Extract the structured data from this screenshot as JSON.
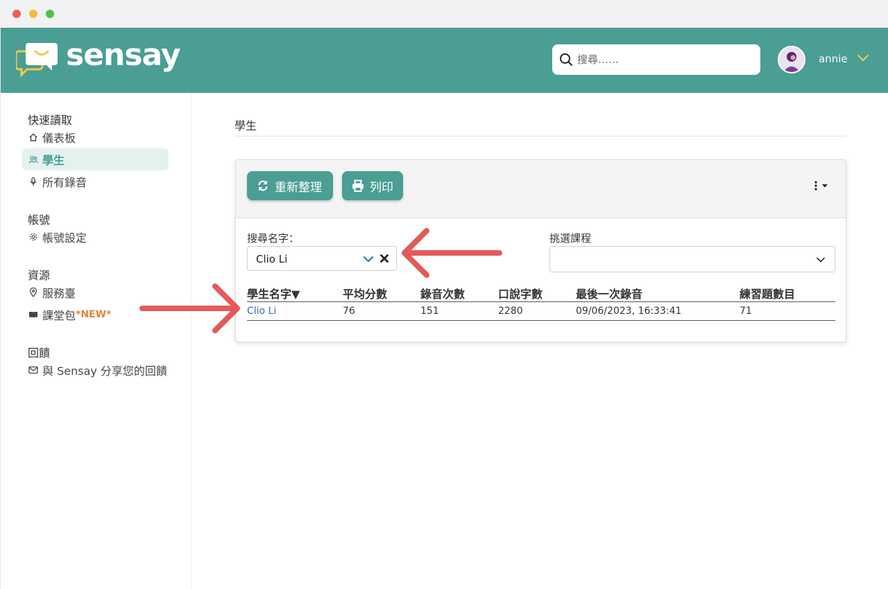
{
  "app": {
    "brand": "sensay"
  },
  "header": {
    "search_placeholder": "搜尋……",
    "username": "annie"
  },
  "sidebar": {
    "sections": [
      {
        "title": "快速讀取",
        "items": [
          {
            "label": "儀表板",
            "icon": "home-icon"
          },
          {
            "label": "學生",
            "icon": "users-icon",
            "active": true
          },
          {
            "label": "所有錄音",
            "icon": "microphone-icon"
          }
        ]
      },
      {
        "title": "帳號",
        "items": [
          {
            "label": "帳號設定",
            "icon": "gear-icon"
          }
        ]
      },
      {
        "title": "資源",
        "items": [
          {
            "label": "服務臺",
            "icon": "location-pin-icon"
          },
          {
            "label": "課堂包",
            "icon": "book-icon",
            "badge": "*NEW*"
          }
        ]
      },
      {
        "title": "回饋",
        "items": [
          {
            "label": "與 Sensay 分享您的回饋",
            "icon": "mail-icon"
          }
        ]
      }
    ]
  },
  "main": {
    "page_title": "學生",
    "toolbar": {
      "refresh_label": "重新整理",
      "print_label": "列印"
    },
    "filters": {
      "name_label": "搜尋名字：",
      "name_value": "Clio Li",
      "course_label": "挑選課程",
      "course_value": ""
    },
    "table": {
      "columns": [
        "學生名字▼",
        "平均分數",
        "錄音次數",
        "口說字數",
        "最後一次錄音",
        "練習題數目"
      ],
      "rows": [
        [
          "Clio Li",
          "76",
          "151",
          "2280",
          "09/06/2023, 16:33:41",
          "71"
        ]
      ]
    }
  },
  "colors": {
    "brand_teal": "#4a9e93",
    "accent_yellow": "#f2c94c",
    "link_blue": "#3a6cb0",
    "annotation_red": "#e45a5a",
    "new_orange": "#e8833a"
  }
}
